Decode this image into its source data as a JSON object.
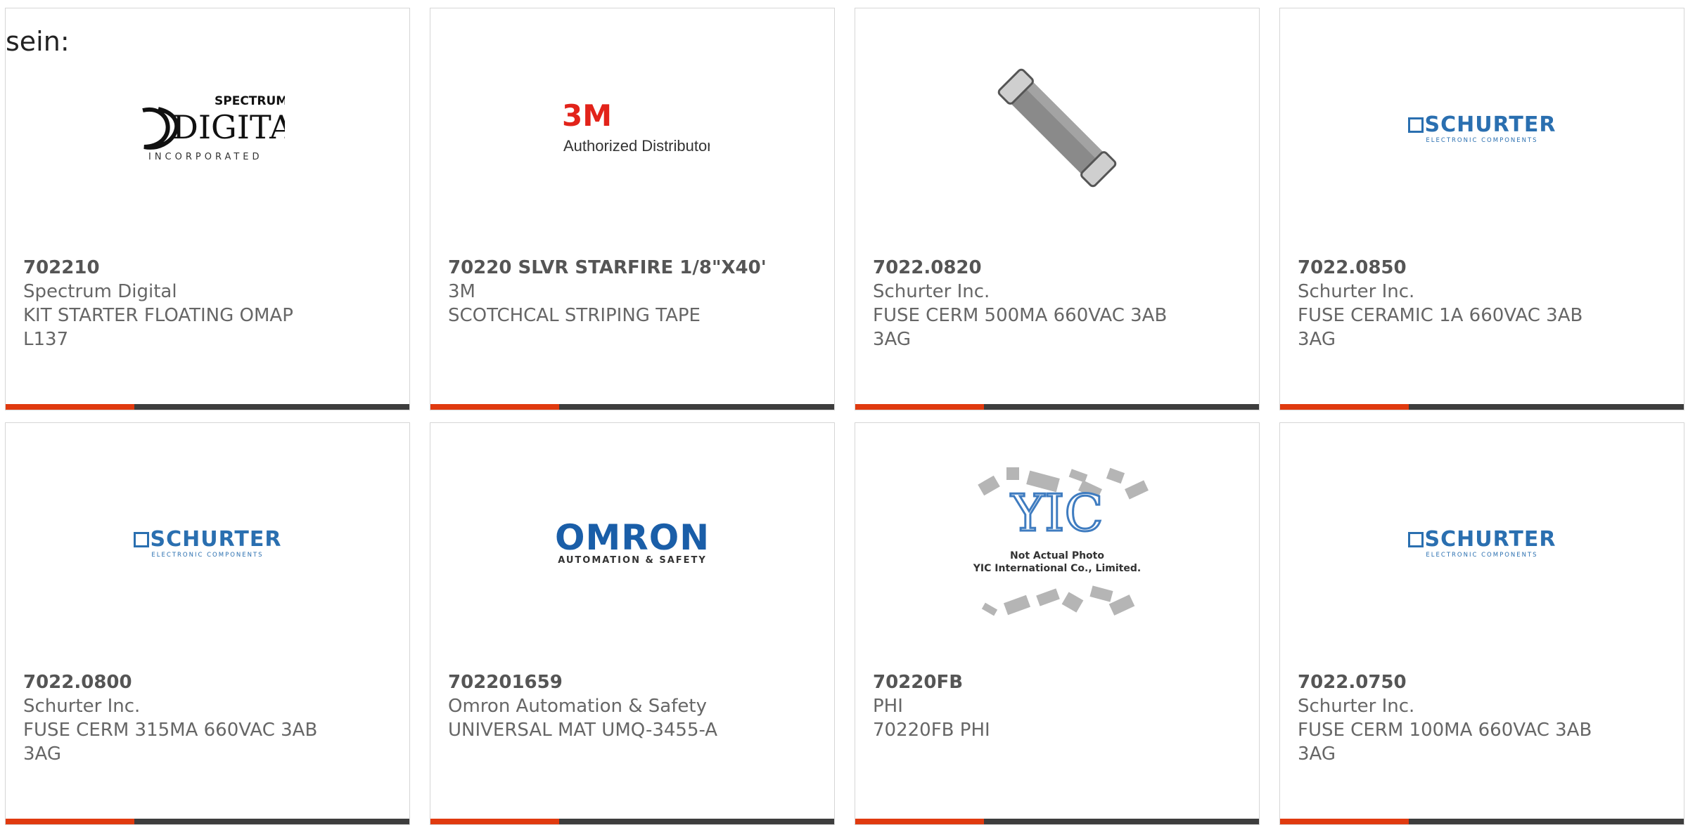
{
  "intro_text": "sein:",
  "brand_colors": {
    "accent": "#e03a0f",
    "bar_dark": "#3d3d3d",
    "schurter_blue": "#2a6fb0",
    "omron_blue": "#1a5ea8",
    "3m_red": "#e2231a"
  },
  "logos": {
    "spectrum_digital": {
      "top": "SPECTRUM",
      "main": "DIGITAL",
      "sub": "INCORPORATED"
    },
    "three_m": {
      "mark": "3M",
      "sub": "Authorized Distributor"
    },
    "schurter": {
      "main": "SCHURTER",
      "sub": "ELECTRONIC COMPONENTS"
    },
    "omron": {
      "main": "OMRON",
      "sub": "AUTOMATION & SAFETY"
    },
    "yic": {
      "mark": "YIC",
      "line1": "Not Actual Photo",
      "line2": "YIC International Co., Limited."
    }
  },
  "products": [
    {
      "part_number": "702210",
      "manufacturer": "Spectrum Digital",
      "desc1": "KIT STARTER FLOATING OMAP",
      "desc2": "L137",
      "image": "spectrum-digital-logo"
    },
    {
      "part_number": "70220 SLVR STARFIRE 1/8\"X40'",
      "manufacturer": "3M",
      "desc1": "SCOTCHCAL STRIPING TAPE",
      "desc2": "",
      "image": "3m-logo"
    },
    {
      "part_number": "7022.0820",
      "manufacturer": "Schurter Inc.",
      "desc1": "FUSE CERM 500MA 660VAC 3AB",
      "desc2": "3AG",
      "image": "fuse-photo"
    },
    {
      "part_number": "7022.0850",
      "manufacturer": "Schurter Inc.",
      "desc1": "FUSE CERAMIC 1A 660VAC 3AB",
      "desc2": "3AG",
      "image": "schurter-logo"
    },
    {
      "part_number": "7022.0800",
      "manufacturer": "Schurter Inc.",
      "desc1": "FUSE CERM 315MA 660VAC 3AB",
      "desc2": "3AG",
      "image": "schurter-logo"
    },
    {
      "part_number": "702201659",
      "manufacturer": "Omron Automation & Safety",
      "desc1": "UNIVERSAL MAT UMQ-3455-A",
      "desc2": "",
      "image": "omron-logo"
    },
    {
      "part_number": "70220FB",
      "manufacturer": "PHI",
      "desc1": "70220FB PHI",
      "desc2": "",
      "image": "yic-placeholder"
    },
    {
      "part_number": "7022.0750",
      "manufacturer": "Schurter Inc.",
      "desc1": "FUSE CERM 100MA 660VAC 3AB",
      "desc2": "3AG",
      "image": "schurter-logo"
    }
  ]
}
